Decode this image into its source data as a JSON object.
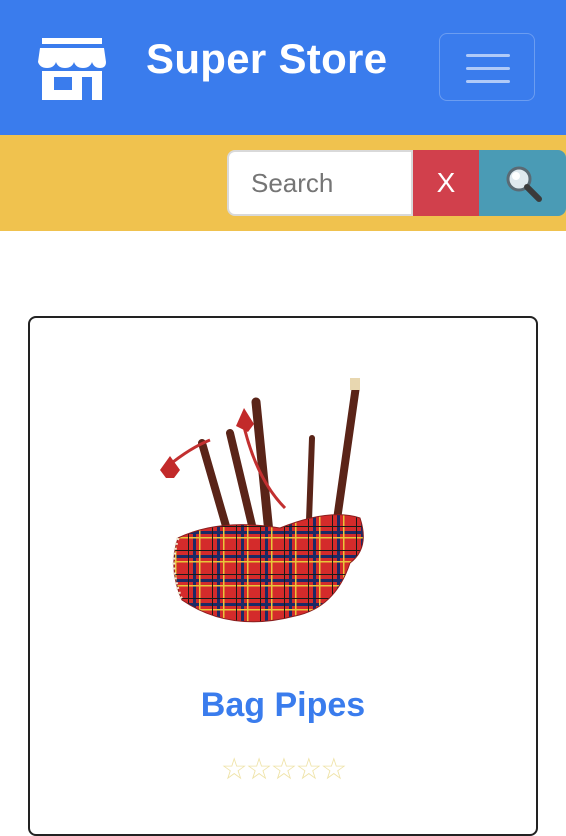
{
  "header": {
    "brand": "Super Store",
    "logo_icon": "store-icon",
    "menu_icon": "hamburger-icon",
    "bg_color": "#3a7ced"
  },
  "search": {
    "placeholder": "Search",
    "clear_label": "X",
    "submit_icon": "magnifier-icon",
    "bar_color": "#f0c24e"
  },
  "product": {
    "name": "Bag Pipes",
    "rating_stars": "☆☆☆☆☆",
    "rating_value": 0,
    "rating_max": 5,
    "image_icon": "bagpipes-image"
  }
}
